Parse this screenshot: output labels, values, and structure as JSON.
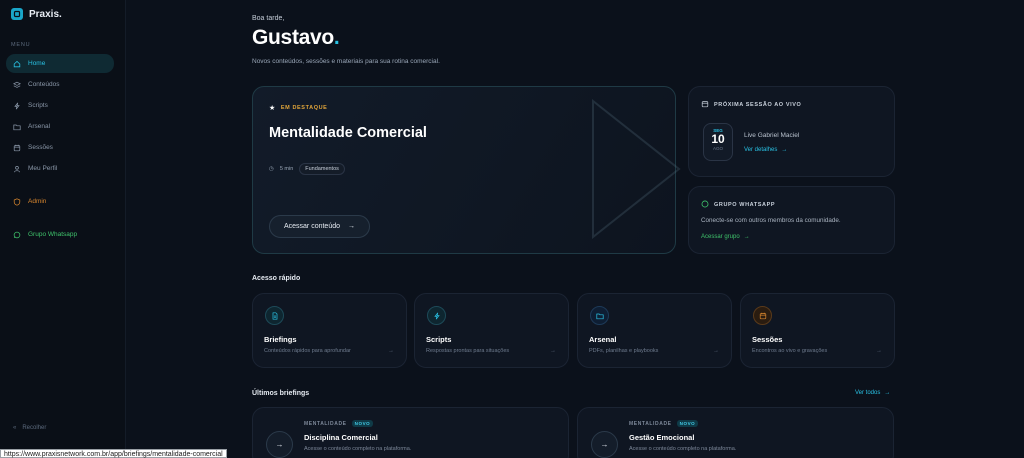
{
  "app": {
    "brand": "Praxis."
  },
  "sidebar": {
    "menu_label": "MENU",
    "items": [
      {
        "label": "Home",
        "icon": "home-icon"
      },
      {
        "label": "Conteúdos",
        "icon": "layers-icon"
      },
      {
        "label": "Scripts",
        "icon": "bolt-icon"
      },
      {
        "label": "Arsenal",
        "icon": "folder-icon"
      },
      {
        "label": "Sessões",
        "icon": "calendar-icon"
      },
      {
        "label": "Meu Perfil",
        "icon": "user-icon"
      }
    ],
    "admin_label": "Admin",
    "whatsapp_label": "Grupo Whatsapp",
    "collapse_label": "Recolher"
  },
  "header": {
    "greeting": "Boa tarde,",
    "name": "Gustavo",
    "name_dot": ".",
    "subtitle": "Novos conteúdos, sessões e materiais para sua rotina comercial."
  },
  "featured": {
    "badge": "EM DESTAQUE",
    "title": "Mentalidade Comercial",
    "duration": "5 min",
    "tag": "Fundamentos",
    "cta": "Acessar conteúdo"
  },
  "live_session": {
    "label": "PRÓXIMA SESSÃO AO VIVO",
    "dow": "SEG",
    "day": "10",
    "month": "AGO",
    "title": "Live Gabriel Maciel",
    "link": "Ver detalhes"
  },
  "whatsapp_group": {
    "label": "GRUPO WHATSAPP",
    "description": "Conecte-se com outros membros da comunidade.",
    "link": "Acessar grupo"
  },
  "quick_access": {
    "title": "Acesso rápido",
    "items": [
      {
        "title": "Briefings",
        "desc": "Conteúdos rápidos para aprofundar",
        "icon": "document-icon",
        "color": "#29c1e3"
      },
      {
        "title": "Scripts",
        "desc": "Respostas prontas para situações",
        "icon": "bolt-icon",
        "color": "#29c1e3"
      },
      {
        "title": "Arsenal",
        "desc": "PDFs, planilhas e playbooks",
        "icon": "folder-icon",
        "color": "#29c1e3"
      },
      {
        "title": "Sessões",
        "desc": "Encontros ao vivo e gravações",
        "icon": "calendar-icon",
        "color": "#d8862e"
      }
    ]
  },
  "briefings": {
    "title": "Últimos briefings",
    "see_all": "Ver todos",
    "items": [
      {
        "category": "MENTALIDADE",
        "badge": "NOVO",
        "title": "Disciplina Comercial",
        "desc": "Acesse o conteúdo completo na plataforma."
      },
      {
        "category": "MENTALIDADE",
        "badge": "NOVO",
        "title": "Gestão Emocional",
        "desc": "Acesse o conteúdo completo na plataforma."
      }
    ]
  },
  "status_bar": {
    "url": "https://www.praxisnetwork.com.br/app/briefings/mentalidade-comercial"
  }
}
